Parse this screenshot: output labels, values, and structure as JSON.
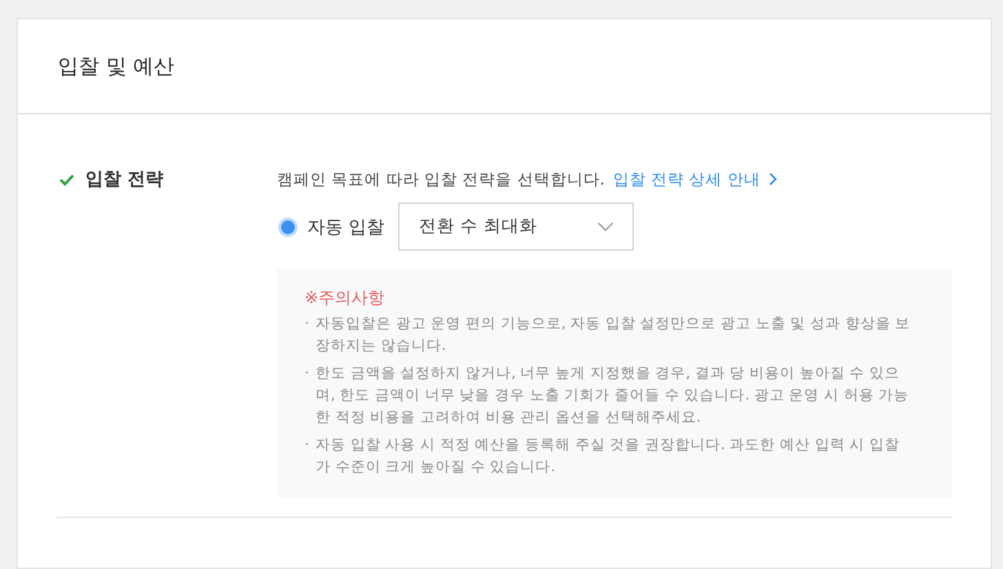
{
  "section": {
    "title": "입찰 및 예산"
  },
  "field": {
    "label": "입찰 전략",
    "complete": true,
    "description": "캠페인 목표에 따라 입찰 전략을 선택합니다.",
    "link": "입찰 전략 상세 안내",
    "options": [
      {
        "label": "자동 입찰",
        "selected": true
      }
    ],
    "dropdown": {
      "value": "전환 수 최대화"
    }
  },
  "notice": {
    "title": "※주의사항",
    "notes": [
      {
        "bullet": "·",
        "text": "자동입찰은 광고 운영 편의 기능으로, 자동 입찰 설정만으로 광고 노출 및 성과 향상을 보장하지는 않습니다."
      },
      {
        "bullet": "·",
        "text": "한도 금액을 설정하지 않거나, 너무 높게 지정했을 경우, 결과 당 비용이 높아질 수 있으며, 한도 금액이 너무 낮을 경우 노출 기회가 줄어들 수 있습니다. 광고 운영 시 허용 가능한 적정 비용을 고려하여 비용 관리 옵션을 선택해주세요."
      },
      {
        "bullet": "·",
        "text": "자동 입찰 사용 시 적정 예산을 등록해 주실 것을 권장합니다. 과도한 예산 입력 시 입찰가 수준이 크게 높아질 수 있습니다."
      }
    ]
  }
}
